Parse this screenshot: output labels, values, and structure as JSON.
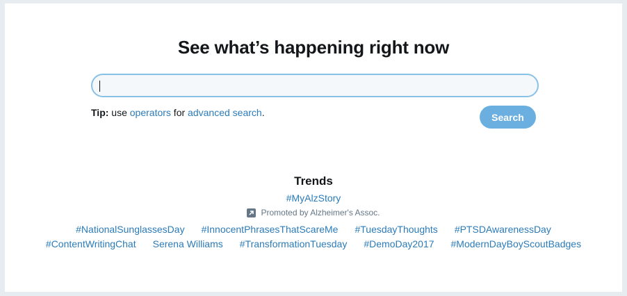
{
  "headline": "See what’s happening right now",
  "search": {
    "value": "",
    "placeholder": "",
    "button_label": "Search"
  },
  "tip": {
    "label": "Tip:",
    "text_1": " use ",
    "operators_link": "operators",
    "text_2": " for ",
    "advanced_link": "advanced search",
    "text_3": "."
  },
  "trends": {
    "title": "Trends",
    "promoted": {
      "label": "#MyAlzStory",
      "promoted_by": "Promoted by Alzheimer's Assoc.",
      "icon": "promoted-arrow-icon"
    },
    "rows": [
      [
        "#NationalSunglassesDay",
        "#InnocentPhrasesThatScareMe",
        "#TuesdayThoughts",
        "#PTSDAwarenessDay"
      ],
      [
        "#ContentWritingChat",
        "Serena Williams",
        "#TransformationTuesday",
        "#DemoDay2017",
        "#ModernDayBoyScoutBadges"
      ]
    ]
  },
  "colors": {
    "link": "#2b7bb9",
    "button": "#6bafe0",
    "input_border": "#88c1e8",
    "page_bg": "#e6ecf0"
  }
}
